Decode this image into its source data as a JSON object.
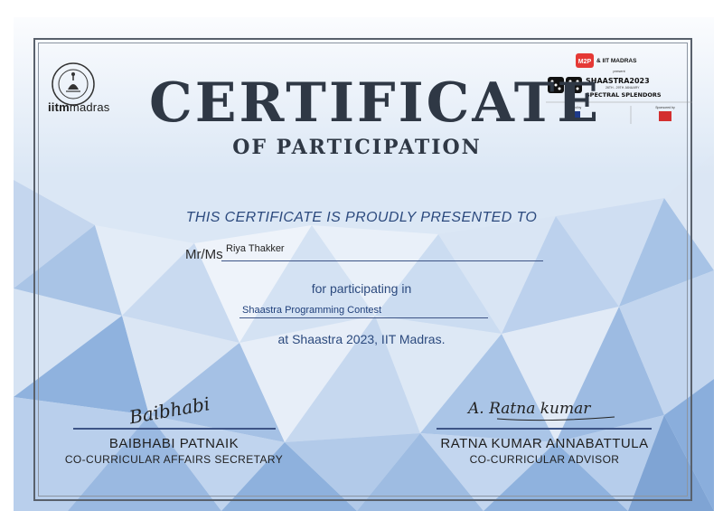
{
  "iitm": {
    "word_bold": "iitm",
    "word_rest": "madras"
  },
  "sponsor": {
    "m2p": "M2P",
    "and_text": "& IIT MADRAS",
    "present": "present",
    "event": "SHAASTRA2023",
    "dates": "26TH - 29TH JANUARY",
    "theme": "SPECTRAL SPLENDORS",
    "powered_by": "Powered by",
    "sponsored_by": "Sponsored by"
  },
  "certificate": {
    "title": "CERTIFICATE",
    "subtitle": "OF PARTICIPATION",
    "presented": "THIS CERTIFICATE IS PROUDLY PRESENTED TO",
    "name_prefix": "Mr/Ms",
    "name": "Riya Thakker",
    "for_text": "for participating in",
    "event_name": "Shaastra Programming Contest",
    "at_text": "at Shaastra 2023, IIT Madras."
  },
  "signatories": [
    {
      "signature": "Baibhabi",
      "name": "BAIBHABI PATNAIK",
      "role": "CO-CURRICULAR AFFAIRS SECRETARY"
    },
    {
      "signature": "A. Ratna kumar",
      "name": "RATNA KUMAR  ANNABATTULA",
      "role": "CO-CURRICULAR ADVISOR"
    }
  ],
  "colors": {
    "frame": "#59616c",
    "title": "#2f3845",
    "accent": "#2c4a7e",
    "poly_dark": "#7fa4d4",
    "m2p_red": "#e53935"
  }
}
